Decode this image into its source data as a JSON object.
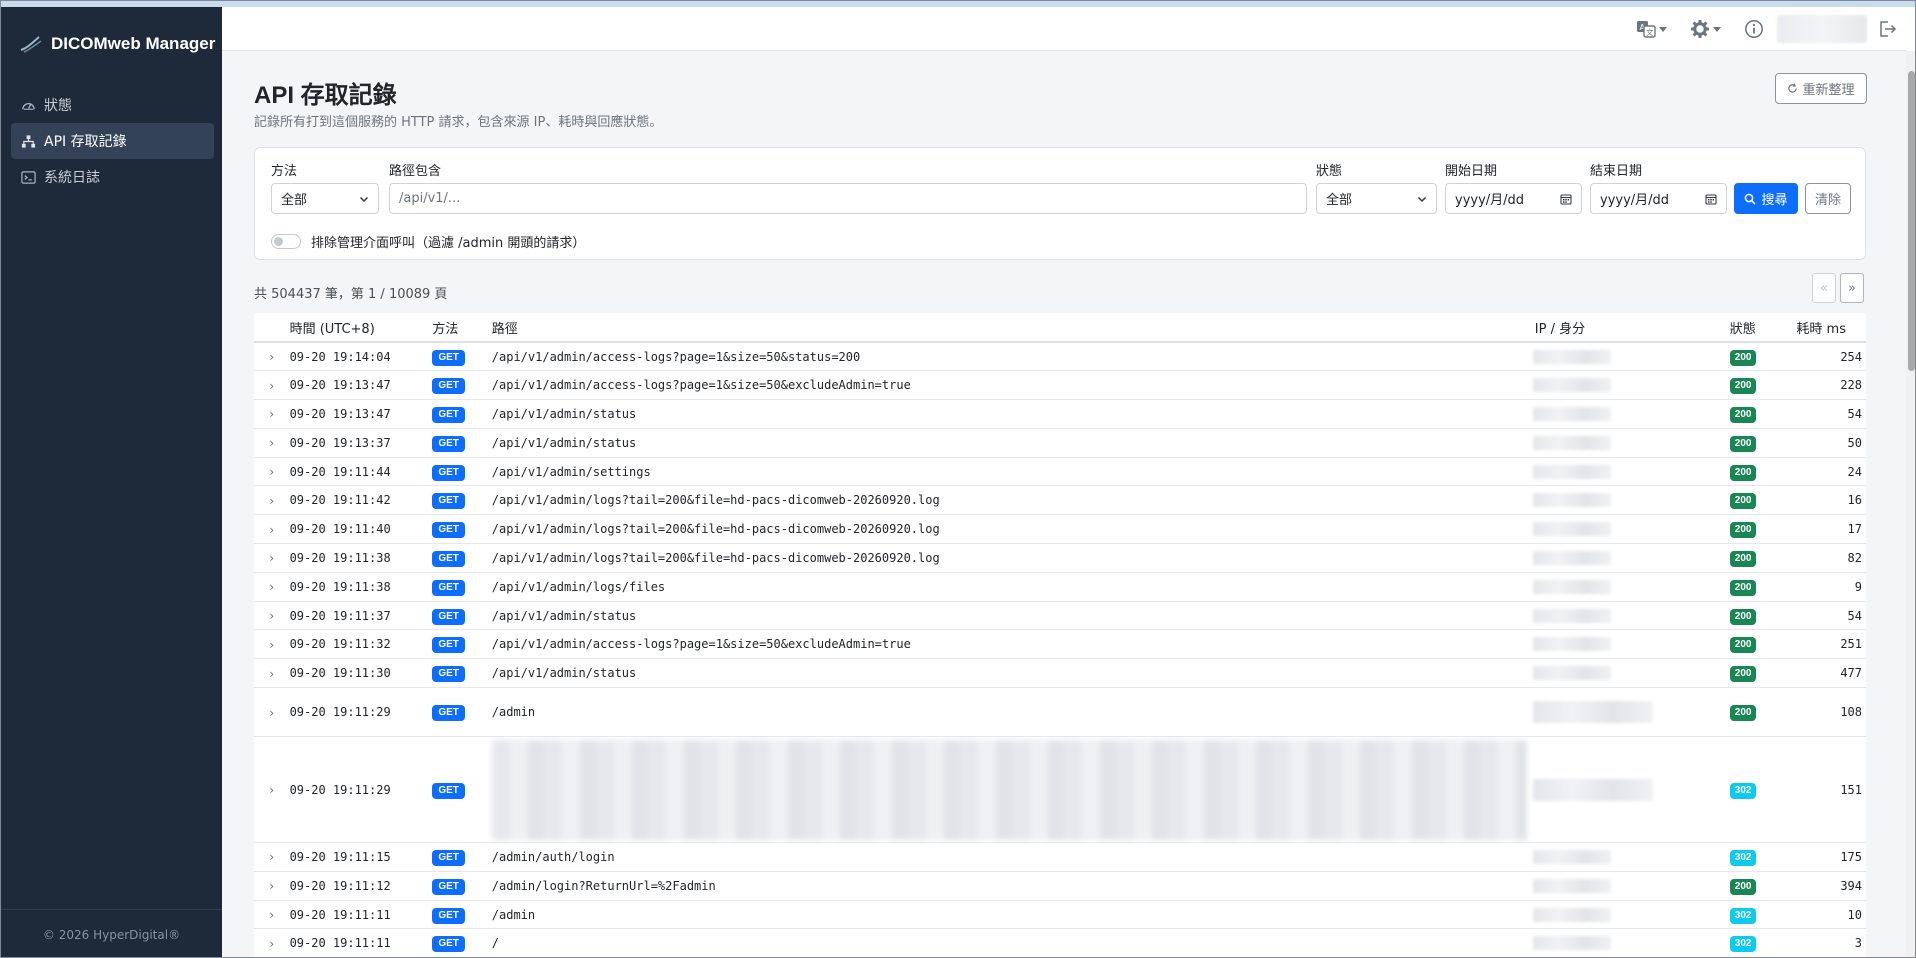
{
  "app": {
    "title": "DICOMweb Manager",
    "footer": "© 2026 HyperDigital®"
  },
  "sidebar": {
    "items": [
      {
        "label": "狀態",
        "icon": "gauge-icon"
      },
      {
        "label": "API 存取記錄",
        "icon": "sitemap-icon",
        "active": true
      },
      {
        "label": "系統日誌",
        "icon": "terminal-icon"
      }
    ]
  },
  "topbar": {
    "icons": [
      "translate-icon",
      "gear-icon",
      "info-icon",
      "logout-icon"
    ]
  },
  "page": {
    "title": "API 存取記錄",
    "subtitle": "記錄所有打到這個服務的 HTTP 請求，包含來源 IP、耗時與回應狀態。",
    "refresh_label": "重新整理"
  },
  "filters": {
    "method_label": "方法",
    "method_value": "全部",
    "path_label": "路徑包含",
    "path_placeholder": "/api/v1/...",
    "status_label": "狀態",
    "status_value": "全部",
    "start_label": "開始日期",
    "start_placeholder": "yyyy/月/dd",
    "end_label": "結束日期",
    "end_placeholder": "yyyy/月/dd",
    "search_label": "搜尋",
    "clear_label": "清除",
    "exclude_admin_label": "排除管理介面呼叫（過濾 /admin 開頭的請求）",
    "exclude_admin": false
  },
  "summary": "共 504437 筆，第 1 / 10089 頁",
  "pagination": {
    "prev": "«",
    "next": "»"
  },
  "colors": {
    "primary": "#0d6efd",
    "success": "#198754",
    "info": "#0dcaf0",
    "sidebar": "#1e2a39"
  },
  "table": {
    "headers": [
      "時間 (UTC+8)",
      "方法",
      "路徑",
      "IP / 身分",
      "狀態",
      "耗時 ms"
    ],
    "rows": [
      {
        "time": "09-20 19:14:04",
        "method": "GET",
        "path": "/api/v1/admin/access-logs?page=1&size=50&status=200",
        "status": "200",
        "ms": "254"
      },
      {
        "time": "09-20 19:13:47",
        "method": "GET",
        "path": "/api/v1/admin/access-logs?page=1&size=50&excludeAdmin=true",
        "status": "200",
        "ms": "228"
      },
      {
        "time": "09-20 19:13:47",
        "method": "GET",
        "path": "/api/v1/admin/status",
        "status": "200",
        "ms": "54"
      },
      {
        "time": "09-20 19:13:37",
        "method": "GET",
        "path": "/api/v1/admin/status",
        "status": "200",
        "ms": "50"
      },
      {
        "time": "09-20 19:11:44",
        "method": "GET",
        "path": "/api/v1/admin/settings",
        "status": "200",
        "ms": "24"
      },
      {
        "time": "09-20 19:11:42",
        "method": "GET",
        "path": "/api/v1/admin/logs?tail=200&file=hd-pacs-dicomweb-20260920.log",
        "status": "200",
        "ms": "16"
      },
      {
        "time": "09-20 19:11:40",
        "method": "GET",
        "path": "/api/v1/admin/logs?tail=200&file=hd-pacs-dicomweb-20260920.log",
        "status": "200",
        "ms": "17"
      },
      {
        "time": "09-20 19:11:38",
        "method": "GET",
        "path": "/api/v1/admin/logs?tail=200&file=hd-pacs-dicomweb-20260920.log",
        "status": "200",
        "ms": "82"
      },
      {
        "time": "09-20 19:11:38",
        "method": "GET",
        "path": "/api/v1/admin/logs/files",
        "status": "200",
        "ms": "9"
      },
      {
        "time": "09-20 19:11:37",
        "method": "GET",
        "path": "/api/v1/admin/status",
        "status": "200",
        "ms": "54"
      },
      {
        "time": "09-20 19:11:32",
        "method": "GET",
        "path": "/api/v1/admin/access-logs?page=1&size=50&excludeAdmin=true",
        "status": "200",
        "ms": "251"
      },
      {
        "time": "09-20 19:11:30",
        "method": "GET",
        "path": "/api/v1/admin/status",
        "status": "200",
        "ms": "477"
      },
      {
        "time": "09-20 19:11:29",
        "method": "GET",
        "path": "/admin",
        "status": "200",
        "ms": "108",
        "tall": "m"
      },
      {
        "time": "09-20 19:11:29",
        "method": "GET",
        "path": "",
        "status": "302",
        "ms": "151",
        "tall": "l"
      },
      {
        "time": "09-20 19:11:15",
        "method": "GET",
        "path": "/admin/auth/login",
        "status": "302",
        "ms": "175"
      },
      {
        "time": "09-20 19:11:12",
        "method": "GET",
        "path": "/admin/login?ReturnUrl=%2Fadmin",
        "status": "200",
        "ms": "394"
      },
      {
        "time": "09-20 19:11:11",
        "method": "GET",
        "path": "/admin",
        "status": "302",
        "ms": "10"
      },
      {
        "time": "09-20 19:11:11",
        "method": "GET",
        "path": "/",
        "status": "302",
        "ms": "3"
      }
    ]
  }
}
